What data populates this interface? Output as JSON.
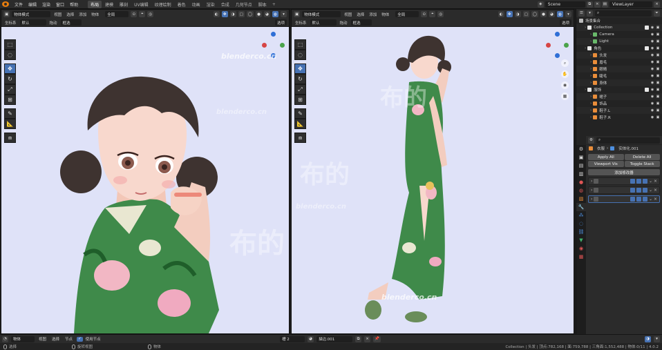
{
  "topbar": {
    "menus": [
      "文件",
      "编辑",
      "渲染",
      "窗口",
      "帮助"
    ],
    "workspaces": [
      {
        "label": "布局",
        "active": true
      },
      {
        "label": "建模",
        "active": false
      },
      {
        "label": "雕刻",
        "active": false
      },
      {
        "label": "UV编辑",
        "active": false
      },
      {
        "label": "纹理绘制",
        "active": false
      },
      {
        "label": "着色",
        "active": false
      },
      {
        "label": "动画",
        "active": false
      },
      {
        "label": "渲染",
        "active": false
      },
      {
        "label": "合成",
        "active": false
      },
      {
        "label": "几何节点",
        "active": false
      },
      {
        "label": "脚本",
        "active": false
      }
    ],
    "scene": "Scene",
    "view_layer": "ViewLayer"
  },
  "viewport_left": {
    "mode": "物体模式",
    "menus": [
      "视图",
      "选择",
      "添加",
      "物体"
    ],
    "transform": "全局",
    "orientation_label": "坐标系",
    "orientation_value": "默认",
    "drag_label": "拖动",
    "drag_value": "框选",
    "options": "选项"
  },
  "viewport_right": {
    "mode": "物体模式",
    "menus": [
      "视图",
      "选择",
      "添加",
      "物体"
    ],
    "transform": "全局",
    "orientation_label": "坐标系",
    "orientation_value": "默认",
    "drag_label": "拖动",
    "drag_value": "框选",
    "options": "选项"
  },
  "watermarks": {
    "url": "blenderco.cn",
    "cn": "布的"
  },
  "outliner": {
    "search_placeholder": "",
    "title": "场景集合",
    "rows": [
      {
        "label": "Collection",
        "depth": 1,
        "color": "#e6e6e6"
      },
      {
        "label": "Camera",
        "depth": 2,
        "color": "#69b96b"
      },
      {
        "label": "Light",
        "depth": 2,
        "color": "#69b96b"
      },
      {
        "label": "角色",
        "depth": 1,
        "color": "#e6e6e6"
      },
      {
        "label": "头发",
        "depth": 2,
        "color": "#e98d3a"
      },
      {
        "label": "眉毛",
        "depth": 2,
        "color": "#e98d3a"
      },
      {
        "label": "眼睛",
        "depth": 2,
        "color": "#e98d3a"
      },
      {
        "label": "睫毛",
        "depth": 2,
        "color": "#e98d3a"
      },
      {
        "label": "身体",
        "depth": 2,
        "color": "#e98d3a"
      },
      {
        "label": "服饰",
        "depth": 1,
        "color": "#e6e6e6"
      },
      {
        "label": "裙子",
        "depth": 2,
        "color": "#e98d3a"
      },
      {
        "label": "饰品",
        "depth": 2,
        "color": "#e98d3a"
      },
      {
        "label": "鞋子.L",
        "depth": 2,
        "color": "#e98d3a"
      },
      {
        "label": "鞋子.R",
        "depth": 2,
        "color": "#e98d3a"
      }
    ]
  },
  "properties": {
    "breadcrumb_a": "衣服",
    "breadcrumb_b": "实体化.001",
    "buttons": [
      "Apply All",
      "Delete All",
      "Viewport Vis",
      "Toggle Stack"
    ],
    "add_modifier": "添加修改器",
    "modifiers": [
      "",
      "",
      ""
    ]
  },
  "bottombar": {
    "mode": "物体",
    "menus": [
      "视图",
      "选择",
      "节点"
    ],
    "use_nodes": "使用节点",
    "slot": "槽 2",
    "material": "描边.001"
  },
  "statusbar": {
    "select": "选择",
    "rotate": "旋转视图",
    "context": "物体",
    "stats": "Collection | 头发 | 顶点:782,168 | 面:759,788 | 三角面:1,552,488 | 物体:0/11 | 4.0.2"
  }
}
